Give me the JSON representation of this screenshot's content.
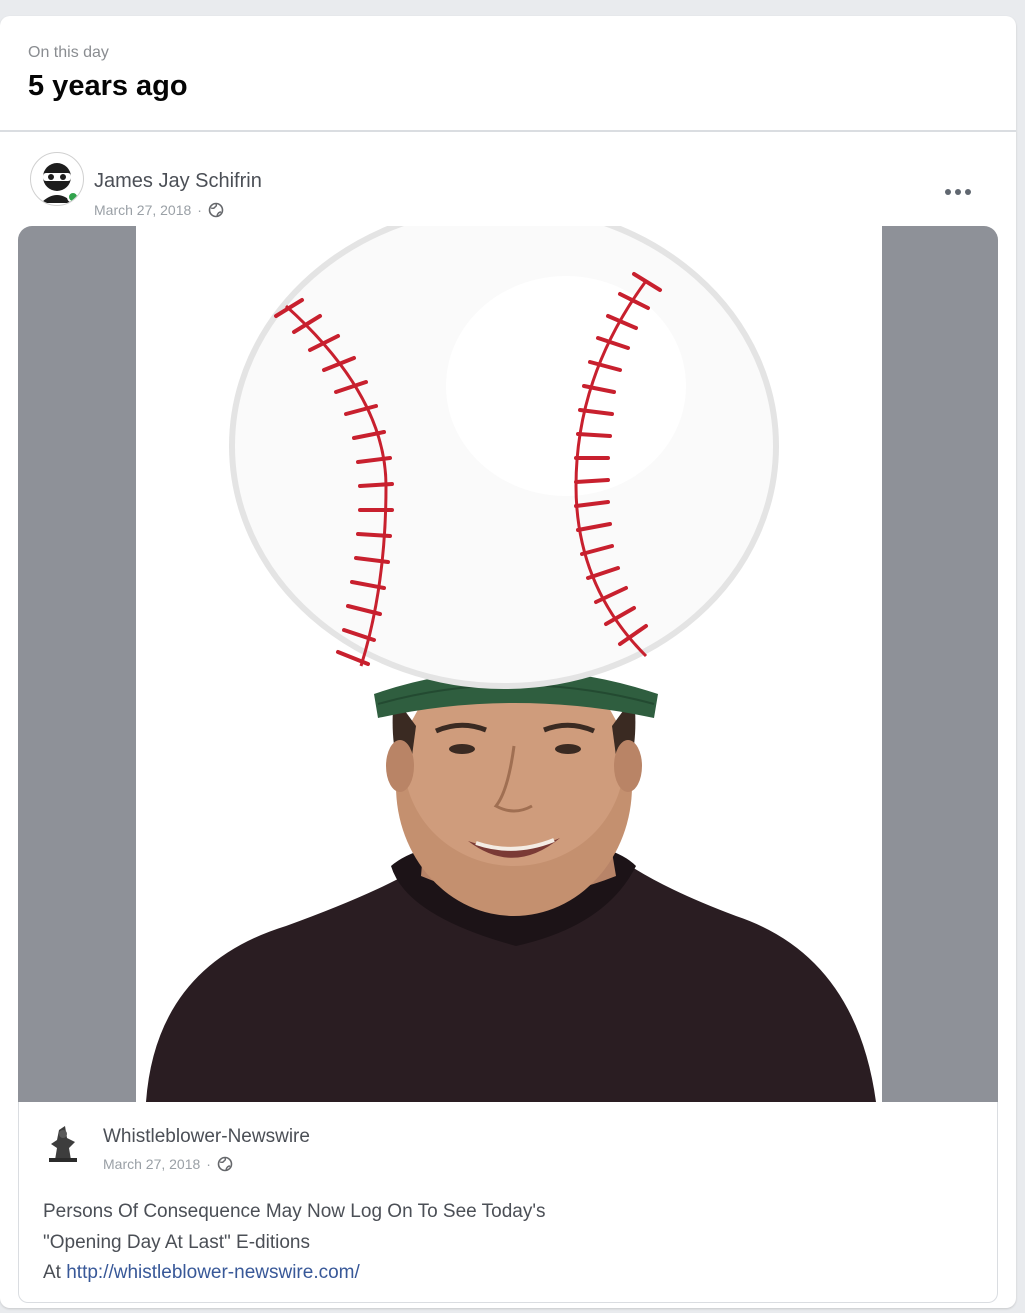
{
  "memory": {
    "label": "On this day",
    "title": "5 years ago"
  },
  "post": {
    "author": "James Jay Schifrin",
    "date": "March 27, 2018",
    "separator": "·",
    "more_icon": "more-options-icon",
    "privacy_icon": "globe-icon"
  },
  "shared": {
    "page_name": "Whistleblower-Newswire",
    "date": "March 27, 2018",
    "separator": "·",
    "text_line1": "Persons Of Consequence May Now Log On To See Today's",
    "text_line2": "\"Opening Day At Last\" E-ditions",
    "link_prefix": "At ",
    "link_url": "http://whistleblower-newswire.com/"
  },
  "colors": {
    "stitch_red": "#c8202e",
    "cap_green": "#2f5e3f",
    "letterbox_gray": "#8e9198",
    "link_blue": "#385898"
  }
}
